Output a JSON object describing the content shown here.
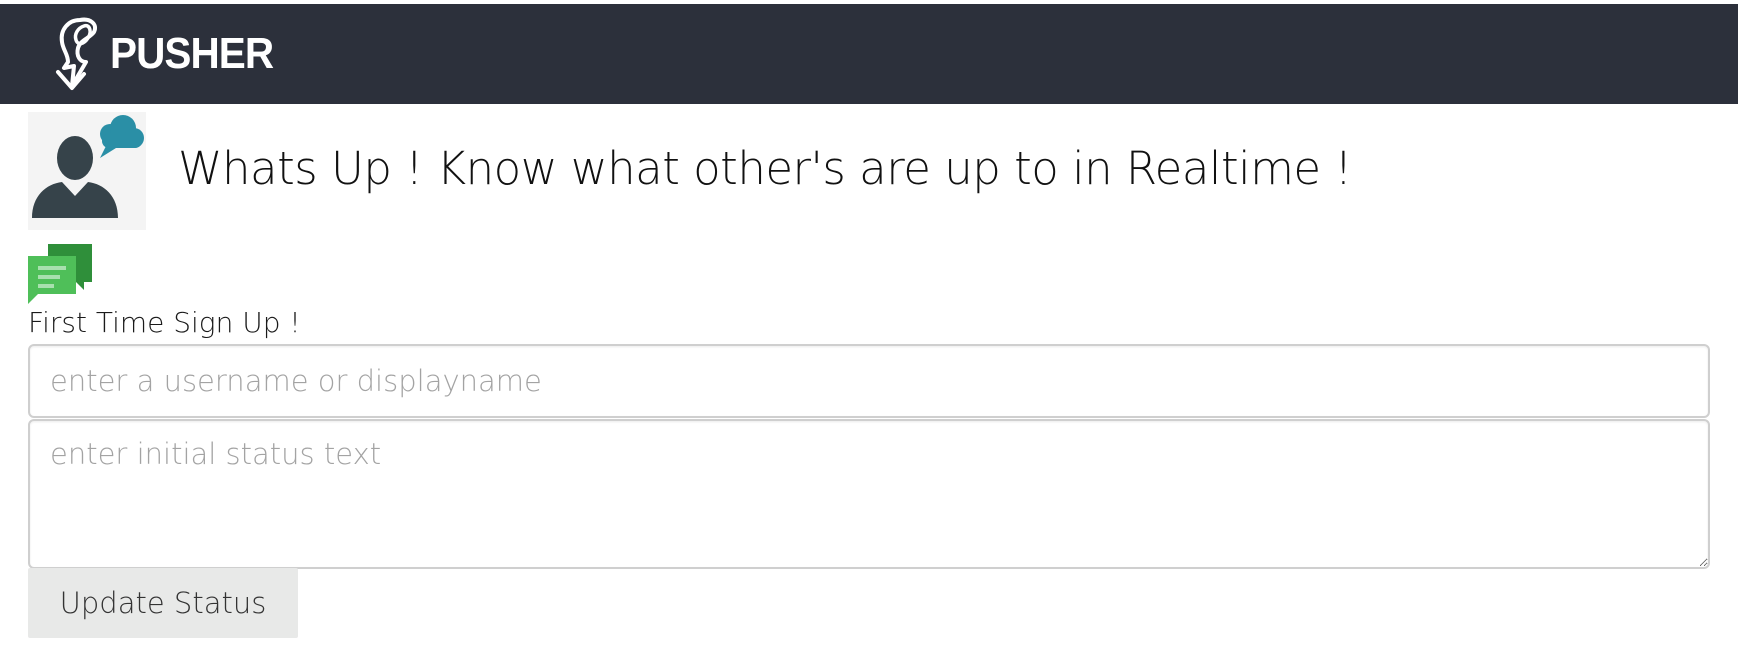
{
  "navbar": {
    "brand_text": "PUSHER",
    "logo_icon": "pusher-logo-icon",
    "background": "#2c303b"
  },
  "hero": {
    "title": "Whats Up ! Know what other's are up to in Realtime !",
    "avatar_icon": "user-thought-bubble-icon",
    "bubble_color": "#2a8fa6"
  },
  "signup": {
    "chat_icon": "chat-bubbles-icon",
    "label": "First Time Sign Up !",
    "username_placeholder": "enter a username or displayname",
    "status_placeholder": "enter initial status text",
    "update_button_label": "Update Status"
  },
  "colors": {
    "chat_green_dark": "#2f8f3a",
    "chat_green_light": "#4fbf59",
    "button_bg": "#e8e9e8"
  }
}
